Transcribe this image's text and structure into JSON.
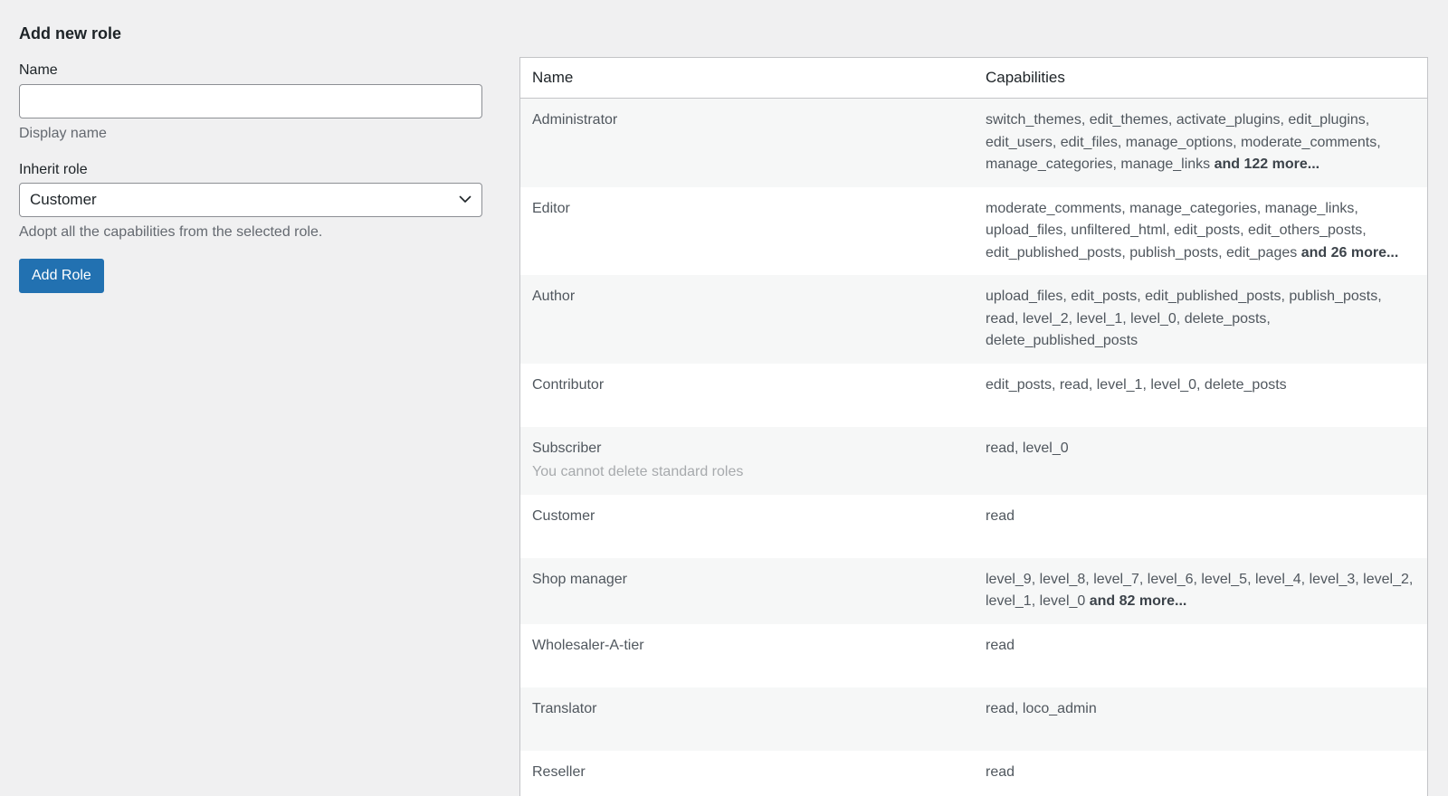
{
  "form": {
    "title": "Add new role",
    "name_label": "Name",
    "name_value": "",
    "name_help": "Display name",
    "inherit_label": "Inherit role",
    "inherit_selected": "Customer",
    "inherit_help": "Adopt all the capabilities from the selected role.",
    "submit_label": "Add Role"
  },
  "table": {
    "headers": {
      "name": "Name",
      "capabilities": "Capabilities"
    },
    "rows": [
      {
        "name": "Administrator",
        "caps": "switch_themes, edit_themes, activate_plugins, edit_plugins, edit_users, edit_files, manage_options, moderate_comments, manage_categories, manage_links ",
        "more": "and 122 more..."
      },
      {
        "name": "Editor",
        "caps": "moderate_comments, manage_categories, manage_links, upload_files, unfiltered_html, edit_posts, edit_others_posts, edit_published_posts, publish_posts, edit_pages ",
        "more": "and 26 more..."
      },
      {
        "name": "Author",
        "caps": "upload_files, edit_posts, edit_published_posts, publish_posts, read, level_2, level_1, level_0, delete_posts, delete_published_posts",
        "more": ""
      },
      {
        "name": "Contributor",
        "caps": "edit_posts, read, level_1, level_0, delete_posts",
        "more": ""
      },
      {
        "name": "Subscriber",
        "note": "You cannot delete standard roles",
        "caps": "read, level_0",
        "more": ""
      },
      {
        "name": "Customer",
        "caps": "read",
        "more": ""
      },
      {
        "name": "Shop manager",
        "caps": "level_9, level_8, level_7, level_6, level_5, level_4, level_3, level_2, level_1, level_0 ",
        "more": "and 82 more..."
      },
      {
        "name": "Wholesaler-A-tier",
        "caps": "read",
        "more": ""
      },
      {
        "name": "Translator",
        "caps": "read, loco_admin",
        "more": ""
      },
      {
        "name": "Reseller",
        "caps": "read",
        "more": ""
      }
    ]
  },
  "colors": {
    "primary": "#2271b1",
    "background": "#f0f0f1",
    "row_alt": "#f6f7f7"
  }
}
